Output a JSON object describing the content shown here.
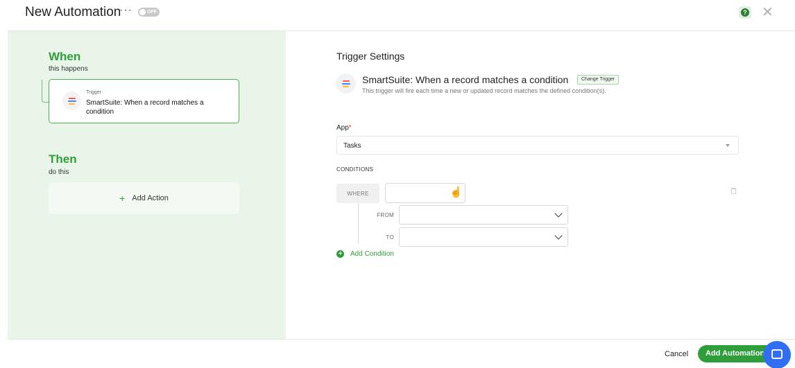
{
  "header": {
    "title": "New Automation",
    "more": "···",
    "toggle_label": "OFF",
    "help_icon": "question-circle-icon",
    "close_icon": "close-icon"
  },
  "left": {
    "when_heading": "When",
    "when_sub": "this happens",
    "trigger_card": {
      "small_label": "Trigger",
      "name": "SmartSuite: When a record matches a condition",
      "icon": "smartsuite-logo-icon"
    },
    "then_heading": "Then",
    "then_sub": "do this",
    "add_action": "Add Action"
  },
  "settings": {
    "title": "Trigger Settings",
    "trigger_name": "SmartSuite: When a record matches a condition",
    "change_trigger": "Change Trigger",
    "trigger_desc": "This trigger will fire each time a new or updated record matches the defined condition(s).",
    "app_label": "App",
    "app_required": "*",
    "app_value": "Tasks",
    "conditions_label": "CONDITIONS",
    "where_label": "WHERE",
    "where_value": "",
    "from_label": "FROM",
    "from_value": "",
    "to_label": "TO",
    "to_value": "",
    "add_condition": "Add Condition"
  },
  "footer": {
    "cancel": "Cancel",
    "add_automation": "Add Automation"
  },
  "colors": {
    "accent": "#2e9e3a",
    "panel_bg": "#eaf5e9",
    "chat_button": "#2f6ef5"
  }
}
